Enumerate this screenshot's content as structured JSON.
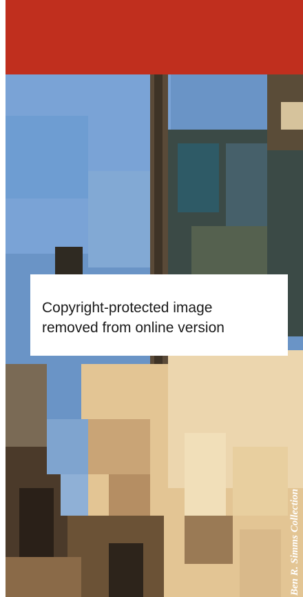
{
  "notice": {
    "line1": "Copyright-protected image",
    "line2": "removed from online version"
  },
  "photo_credit": "Ben R. Simms Collection",
  "colors": {
    "header_red": "#c02f1e",
    "sky_blue": "#6a94c6",
    "building_tan": "#e3c594",
    "dark_wood": "#4a3a2a"
  }
}
